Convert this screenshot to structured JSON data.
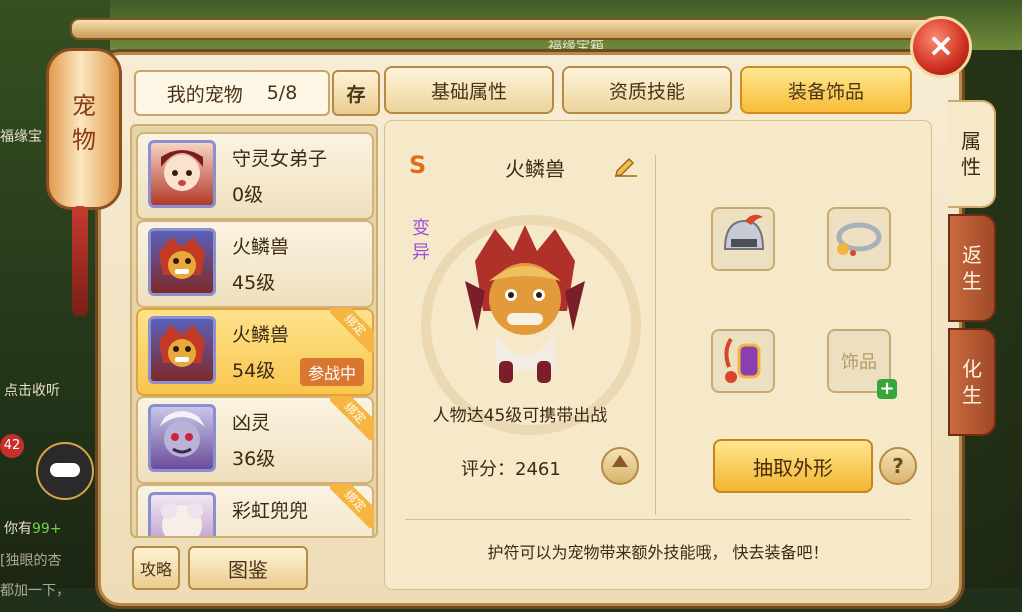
{
  "background": {
    "top_text": "福缘宝箱",
    "left_text_1": "福缘宝",
    "left_text_2": "点击收听",
    "left_text_3": "你有",
    "left_text_3_highlight": "99+",
    "left_text_4": "[独眼的杏",
    "left_text_5": "都加一下，",
    "chat_count": "42"
  },
  "lantern": {
    "title_line1": "宠",
    "title_line2": "物"
  },
  "close_label": "×",
  "header": {
    "my_pets_label": "我的宠物",
    "pet_count": "5/8",
    "store_label": "存"
  },
  "tabs": [
    {
      "label": "基础属性",
      "active": false
    },
    {
      "label": "资质技能",
      "active": false
    },
    {
      "label": "装备饰品",
      "active": true
    }
  ],
  "side_tabs": [
    {
      "label": "属性",
      "active": true
    },
    {
      "label": "返生",
      "active": false
    },
    {
      "label": "化生",
      "active": false
    }
  ],
  "pets": [
    {
      "name": "守灵女弟子",
      "level": "0级",
      "bound": false,
      "in_battle": false,
      "selected": false
    },
    {
      "name": "火鳞兽",
      "level": "45级",
      "bound": false,
      "in_battle": false,
      "selected": false
    },
    {
      "name": "火鳞兽",
      "level": "54级",
      "bound": true,
      "in_battle": true,
      "selected": true
    },
    {
      "name": "凶灵",
      "level": "36级",
      "bound": true,
      "in_battle": false,
      "selected": false
    },
    {
      "name": "彩虹兜兜",
      "level": "",
      "bound": true,
      "in_battle": false,
      "selected": false
    }
  ],
  "bind_label": "绑定",
  "battle_label": "参战中",
  "bottom_buttons": {
    "tips": "攻略",
    "codex": "图鉴"
  },
  "detail": {
    "grade": "S",
    "pet_name": "火鳞兽",
    "variant_label": "变异",
    "requirement": "人物达45级可携带出战",
    "score_label": "评分：",
    "score_value": "2461"
  },
  "equipment": {
    "slots": [
      {
        "name": "helmet",
        "icon": "helmet-icon"
      },
      {
        "name": "collar",
        "icon": "collar-icon"
      },
      {
        "name": "amulet",
        "icon": "amulet-icon"
      },
      {
        "name": "accessory",
        "empty_label": "饰品"
      }
    ],
    "extract_label": "抽取外形",
    "help_label": "?"
  },
  "footer_tip": "护符可以为宠物带来额外技能哦， 快去装备吧！",
  "colors": {
    "accent": "#f7bd38",
    "panel": "#f6e9c9",
    "border": "#b58a45",
    "variant": "#9d4fd6"
  }
}
